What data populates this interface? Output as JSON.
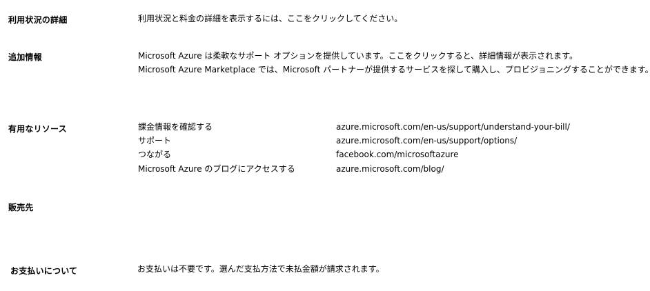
{
  "sections": {
    "usage": {
      "heading": "利用状況の詳細",
      "text": "利用状況と料金の詳細を表示するには、ここをクリックしてください。"
    },
    "additional": {
      "heading": "追加情報",
      "line1": "Microsoft Azure は柔軟なサポート オプションを提供しています。ここをクリックすると、詳細情報が表示されます。",
      "line2": "Microsoft Azure Marketplace では、Microsoft パートナーが提供するサービスを探して購入し、プロビジョニングすることができます。"
    },
    "resources": {
      "heading": "有用なリソース",
      "items": [
        {
          "label": "課金情報を確認する",
          "url": "azure.microsoft.com/en-us/support/understand-your-bill/"
        },
        {
          "label": "サポート",
          "url": "azure.microsoft.com/en-us/support/options/"
        },
        {
          "label": "つながる",
          "url": "facebook.com/microsoftazure"
        },
        {
          "label": "Microsoft Azure のブログにアクセスする",
          "url": "azure.microsoft.com/blog/"
        }
      ]
    },
    "seller": {
      "heading": "販売先"
    },
    "payment": {
      "heading": "お支払いについて",
      "text": "お支払いは不要です。選んだ支払方法で未払金額が請求されます。"
    }
  }
}
